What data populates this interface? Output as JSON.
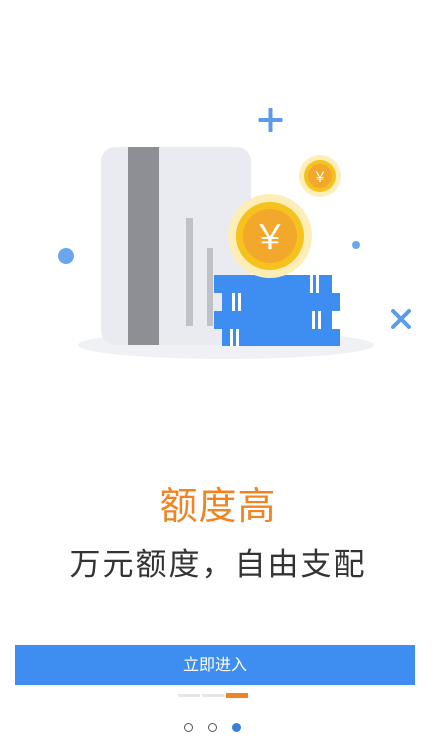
{
  "slide": {
    "headline": "额度高",
    "subtitle": "万元额度，自由支配",
    "coin_symbol": "￥",
    "button_label": "立即进入",
    "pages_total": 3,
    "current_page": 3
  },
  "icons": {
    "illustration": "card-and-coins-illustration",
    "sparkle_plus": "plus-sparkle-icon",
    "sparkle_cross": "cross-sparkle-icon"
  },
  "colors": {
    "accent_orange": "#f08423",
    "primary_blue": "#3d8ef0",
    "indicator_active": "#3a7fd8",
    "text_dark": "#333333"
  }
}
